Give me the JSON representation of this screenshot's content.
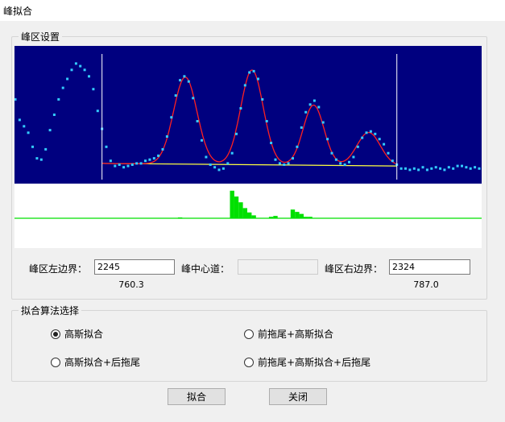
{
  "window": {
    "title": "峰拟合"
  },
  "peak_settings": {
    "group_title": "峰区设置",
    "left_label": "峰区左边界：",
    "left_value": "2245",
    "left_energy": "760.3",
    "center_label": "峰中心道：",
    "center_value": "",
    "right_label": "峰区右边界：",
    "right_value": "2324",
    "right_energy": "787.0"
  },
  "algorithm": {
    "group_title": "拟合算法选择",
    "options": [
      {
        "label": "高斯拟合",
        "checked": true
      },
      {
        "label": "前拖尾+高斯拟合",
        "checked": false
      },
      {
        "label": "高斯拟合+后拖尾",
        "checked": false
      },
      {
        "label": "前拖尾+高斯拟合+后拖尾",
        "checked": false
      }
    ]
  },
  "buttons": {
    "fit": "拟合",
    "close": "关闭"
  },
  "colors": {
    "plot_bg": "#00007f",
    "data_points": "#33ccff",
    "fit_curve": "#ff2020",
    "baseline": "#ffff40",
    "markers": "#ffffff",
    "residual": "#00e000"
  },
  "chart_data": {
    "type": "scatter",
    "spectrum_points": [
      [
        0,
        0.62
      ],
      [
        1,
        0.46
      ],
      [
        2,
        0.41
      ],
      [
        3,
        0.36
      ],
      [
        4,
        0.25
      ],
      [
        5,
        0.16
      ],
      [
        6,
        0.15
      ],
      [
        7,
        0.23
      ],
      [
        8,
        0.38
      ],
      [
        9,
        0.5
      ],
      [
        10,
        0.62
      ],
      [
        11,
        0.71
      ],
      [
        12,
        0.78
      ],
      [
        13,
        0.85
      ],
      [
        14,
        0.9
      ],
      [
        15,
        0.88
      ],
      [
        16,
        0.85
      ],
      [
        17,
        0.8
      ],
      [
        18,
        0.7
      ],
      [
        19,
        0.53
      ],
      [
        20,
        0.39
      ],
      [
        21,
        0.25
      ],
      [
        22,
        0.14
      ],
      [
        23,
        0.1
      ],
      [
        24,
        0.11
      ],
      [
        25,
        0.09
      ],
      [
        26,
        0.1
      ],
      [
        27,
        0.11
      ],
      [
        28,
        0.12
      ],
      [
        29,
        0.12
      ],
      [
        30,
        0.14
      ],
      [
        31,
        0.15
      ],
      [
        32,
        0.16
      ],
      [
        33,
        0.18
      ],
      [
        34,
        0.23
      ],
      [
        35,
        0.33
      ],
      [
        36,
        0.48
      ],
      [
        37,
        0.65
      ],
      [
        38,
        0.77
      ],
      [
        39,
        0.8
      ],
      [
        40,
        0.76
      ],
      [
        41,
        0.63
      ],
      [
        42,
        0.45
      ],
      [
        43,
        0.3
      ],
      [
        44,
        0.17
      ],
      [
        45,
        0.11
      ],
      [
        46,
        0.09
      ],
      [
        47,
        0.07
      ],
      [
        48,
        0.08
      ],
      [
        49,
        0.12
      ],
      [
        50,
        0.2
      ],
      [
        51,
        0.35
      ],
      [
        52,
        0.55
      ],
      [
        53,
        0.73
      ],
      [
        54,
        0.83
      ],
      [
        55,
        0.84
      ],
      [
        56,
        0.78
      ],
      [
        57,
        0.62
      ],
      [
        58,
        0.45
      ],
      [
        59,
        0.28
      ],
      [
        60,
        0.15
      ],
      [
        61,
        0.12
      ],
      [
        62,
        0.11
      ],
      [
        63,
        0.12
      ],
      [
        64,
        0.16
      ],
      [
        65,
        0.25
      ],
      [
        66,
        0.4
      ],
      [
        67,
        0.52
      ],
      [
        68,
        0.58
      ],
      [
        69,
        0.61
      ],
      [
        70,
        0.56
      ],
      [
        71,
        0.44
      ],
      [
        72,
        0.31
      ],
      [
        73,
        0.2
      ],
      [
        74,
        0.15
      ],
      [
        75,
        0.12
      ],
      [
        76,
        0.11
      ],
      [
        77,
        0.13
      ],
      [
        78,
        0.17
      ],
      [
        79,
        0.25
      ],
      [
        80,
        0.32
      ],
      [
        81,
        0.36
      ],
      [
        82,
        0.37
      ],
      [
        83,
        0.35
      ],
      [
        84,
        0.31
      ],
      [
        85,
        0.27
      ],
      [
        86,
        0.2
      ],
      [
        87,
        0.14
      ],
      [
        88,
        0.11
      ],
      [
        89,
        0.08
      ],
      [
        90,
        0.08
      ],
      [
        91,
        0.07
      ],
      [
        92,
        0.08
      ],
      [
        93,
        0.07
      ],
      [
        94,
        0.09
      ],
      [
        95,
        0.07
      ],
      [
        96,
        0.08
      ],
      [
        97,
        0.09
      ],
      [
        98,
        0.08
      ],
      [
        99,
        0.07
      ],
      [
        100,
        0.09
      ],
      [
        101,
        0.08
      ],
      [
        102,
        0.1
      ],
      [
        103,
        0.1
      ],
      [
        104,
        0.09
      ],
      [
        105,
        0.08
      ],
      [
        106,
        0.09
      ],
      [
        107,
        0.08
      ]
    ],
    "region_left_index": 20,
    "region_right_index": 88,
    "fit_peaks": [
      {
        "center": 39.2,
        "height": 0.68,
        "sigma": 2.7
      },
      {
        "center": 54.6,
        "height": 0.74,
        "sigma": 2.6
      },
      {
        "center": 68.8,
        "height": 0.47,
        "sigma": 2.4
      },
      {
        "center": 81.5,
        "height": 0.26,
        "sigma": 2.7
      }
    ],
    "baseline_start": 0.12,
    "baseline_end": 0.1,
    "residuals": [
      {
        "index": 38,
        "value": 0.02
      },
      {
        "index": 50,
        "value": 0.95
      },
      {
        "index": 51,
        "value": 0.75
      },
      {
        "index": 52,
        "value": 0.55
      },
      {
        "index": 53,
        "value": 0.35
      },
      {
        "index": 54,
        "value": 0.2
      },
      {
        "index": 55,
        "value": 0.1
      },
      {
        "index": 59,
        "value": 0.05
      },
      {
        "index": 60,
        "value": 0.08
      },
      {
        "index": 64,
        "value": 0.3
      },
      {
        "index": 65,
        "value": 0.22
      },
      {
        "index": 66,
        "value": 0.15
      },
      {
        "index": 67,
        "value": 0.05
      },
      {
        "index": 68,
        "value": 0.05
      }
    ]
  }
}
